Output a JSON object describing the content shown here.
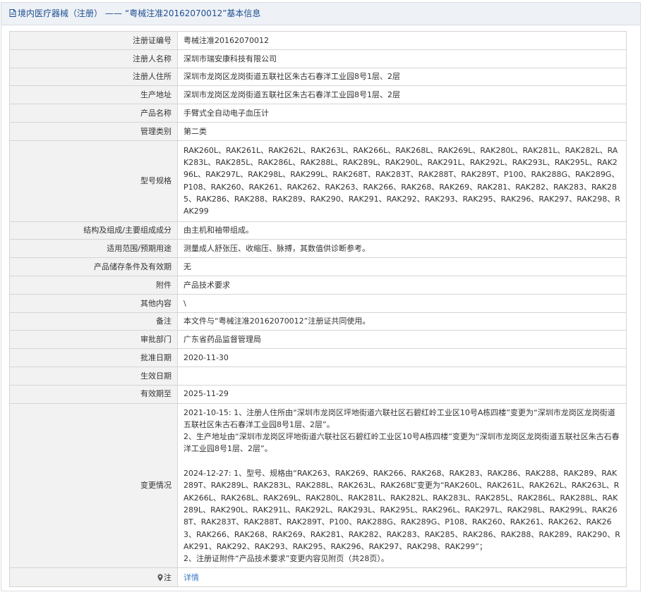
{
  "header": {
    "prefix": "境内医疗器械（注册）",
    "dash": "——",
    "registration_title": "“粤械注准20162070012”基本信息"
  },
  "rows": {
    "reg_no": {
      "label": "注册证编号",
      "value": "粤械注准20162070012"
    },
    "registrant": {
      "label": "注册人名称",
      "value": "深圳市瑞安康科技有限公司"
    },
    "registrant_address": {
      "label": "注册人住所",
      "value": "深圳市龙岗区龙岗街道五联社区朱古石春洋工业园8号1层、2层"
    },
    "production_address": {
      "label": "生产地址",
      "value": "深圳市龙岗区龙岗街道五联社区朱古石春洋工业园8号1层、2层"
    },
    "product_name": {
      "label": "产品名称",
      "value": "手臂式全自动电子血压计"
    },
    "management_class": {
      "label": "管理类别",
      "value": "第二类"
    },
    "models": {
      "label": "型号规格",
      "value": "RAK260L、RAK261L、RAK262L、RAK263L、RAK266L、RAK268L、RAK269L、RAK280L、RAK281L、RAK282L、RAK283L、RAK285L、RAK286L、RAK288L、RAK289L、RAK290L、RAK291L、RAK292L、RAK293L、RAK295L、RAK296L、RAK297L、RAK298L、RAK299L、RAK268T、RAK283T、RAK288T、RAK289T、P100、RAK288G、RAK289G、P108、RAK260、RAK261、RAK262、RAK263、RAK266、RAK268、RAK269、RAK281、RAK282、RAK283、RAK285、RAK286、RAK288、RAK289、RAK290、RAK291、RAK292、RAK293、RAK295、RAK296、RAK297、RAK298、RAK299"
    },
    "structure": {
      "label": "结构及组成/主要组成成分",
      "value": "由主机和袖带组成。"
    },
    "intended_use": {
      "label": "适用范围/预期用途",
      "value": "测量成人舒张压、收缩压、脉搏，其数值供诊断参考。"
    },
    "storage": {
      "label": "产品储存条件及有效期",
      "value": "无"
    },
    "attachment": {
      "label": "附件",
      "value": "产品技术要求"
    },
    "other": {
      "label": "其他内容",
      "value": "\\"
    },
    "remarks": {
      "label": "备注",
      "value": "本文件与“粤械注准20162070012”注册证共同使用。"
    },
    "approval_dept": {
      "label": "审批部门",
      "value": "广东省药品监督管理局"
    },
    "approval_date": {
      "label": "批准日期",
      "value": "2020-11-30"
    },
    "effective_date": {
      "label": "生效日期",
      "value": ""
    },
    "valid_until": {
      "label": "有效期至",
      "value": "2025-11-29"
    },
    "changes": {
      "label": "变更情况",
      "entry1_line1": "2021-10-15: 1、注册人住所由“深圳市龙岗区坪地街道六联社区石碧红岭工业区10号A栋四楼”变更为“深圳市龙岗区龙岗街道五联社区朱古石春洋工业园8号1层、2层”。",
      "entry1_line2": "2、生产地址由“深圳市龙岗区坪地街道六联社区石碧红岭工业区10号A栋四楼”变更为“深圳市龙岗区龙岗街道五联社区朱古石春洋工业园8号1层、2层”。",
      "entry2_line1": "2024-12-27: 1、型号、规格由“RAK263、RAK269、RAK266、RAK268、RAK283、RAK286、RAK288、RAK289、RAK289T、RAK289L、RAK283L、RAK288L、RAK263L、RAK268L”变更为“RAK260L、RAK261L、RAK262L、RAK263L、RAK266L、RAK268L、RAK269L、RAK280L、RAK281L、RAK282L、RAK283L、RAK285L、RAK286L、RAK288L、RAK289L、RAK290L、RAK291L、RAK292L、RAK293L、RAK295L、RAK296L、RAK297L、RAK298L、RAK299L、RAK268T、RAK283T、RAK288T、RAK289T、P100、RAK288G、RAK289G、P108、RAK260、RAK261、RAK262、RAK263、RAK266、RAK268、RAK269、RAK281、RAK282、RAK283、RAK285、RAK286、RAK288、RAK289、RAK290、RAK291、RAK292、RAK293、RAK295、RAK296、RAK297、RAK298、RAK299”；",
      "entry2_line2": "2、注册证附件“产品技术要求”变更内容见附页（共28页）。"
    },
    "note": {
      "label": "注",
      "link_text": "详情"
    }
  },
  "colors": {
    "title_text": "#1d4f91",
    "title_background": "#eef1f6",
    "label_background": "#f2f2f2",
    "border": "#d5d5d5",
    "link": "#3a79c4"
  },
  "icons": {
    "title": "document-icon",
    "note": "map-pin-icon"
  }
}
